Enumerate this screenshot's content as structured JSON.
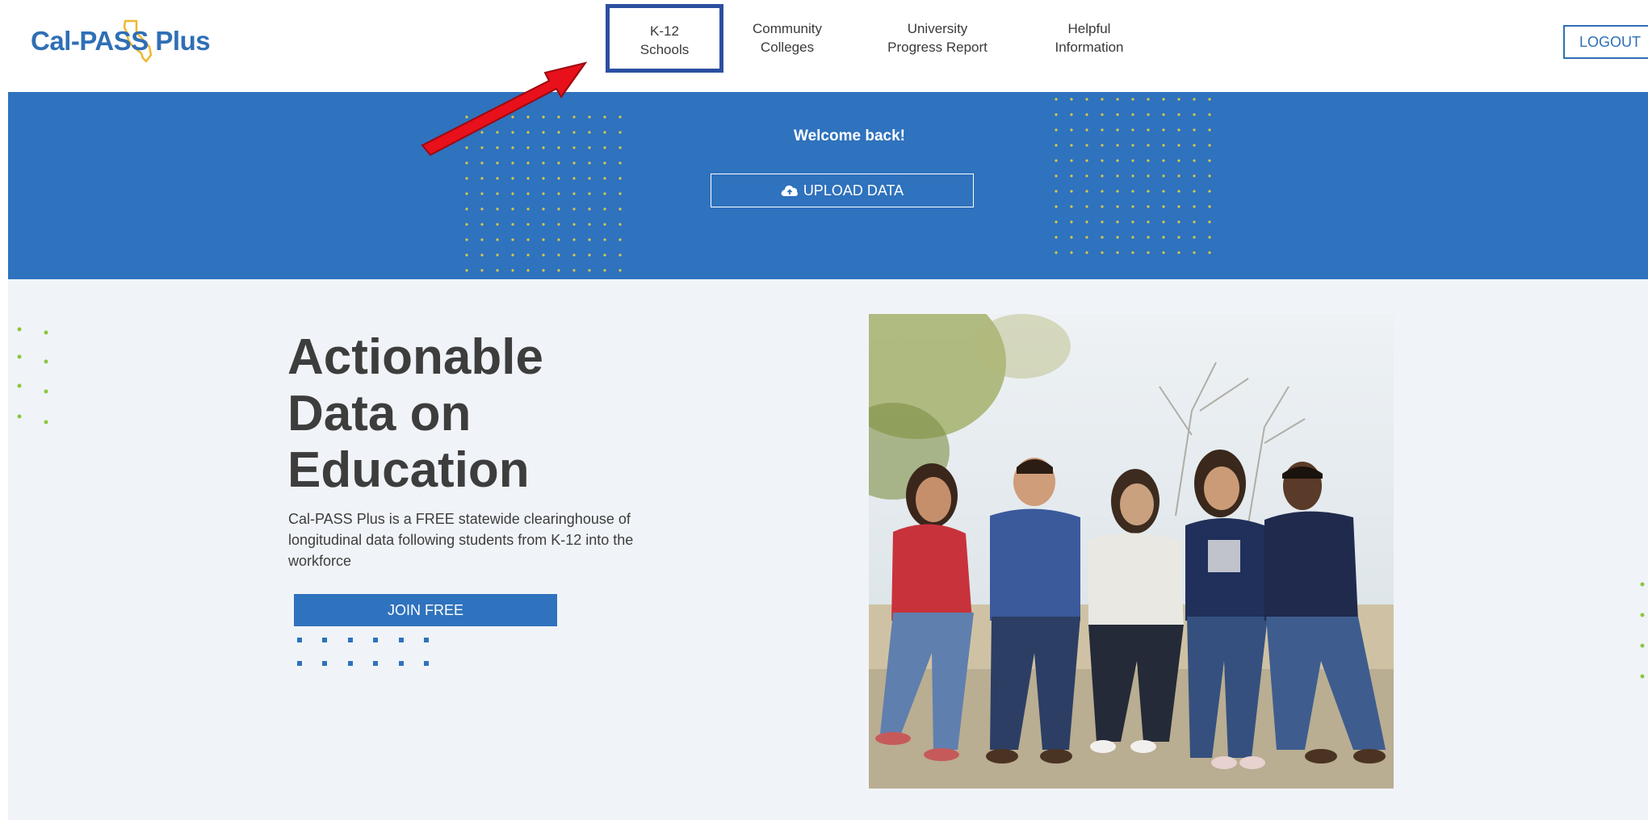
{
  "header": {
    "logo_text": "Cal-PASS Plus",
    "nav": [
      {
        "line1": "K-12",
        "line2": "Schools"
      },
      {
        "line1": "Community",
        "line2": "Colleges"
      },
      {
        "line1": "University",
        "line2": "Progress Report"
      },
      {
        "line1": "Helpful",
        "line2": "Information"
      }
    ],
    "logout_label": "LOGOUT"
  },
  "banner": {
    "welcome": "Welcome back!",
    "upload_label": "UPLOAD DATA"
  },
  "hero": {
    "title_lines": [
      "Actionable",
      "Data on",
      "Education"
    ],
    "description": "Cal-PASS Plus is a FREE statewide clearinghouse of longitudinal data following students from K-12 into the workforce",
    "join_label": "JOIN FREE"
  },
  "colors": {
    "brand_blue": "#2f72bd",
    "highlight_box": "#2c4fa0",
    "annotation_arrow": "#e8101a",
    "banner_dots": "#d8c94a",
    "accent_green_dots": "#8cc63f"
  },
  "icons": {
    "upload": "cloud-upload-icon",
    "logo_mark": "california-map-icon"
  }
}
